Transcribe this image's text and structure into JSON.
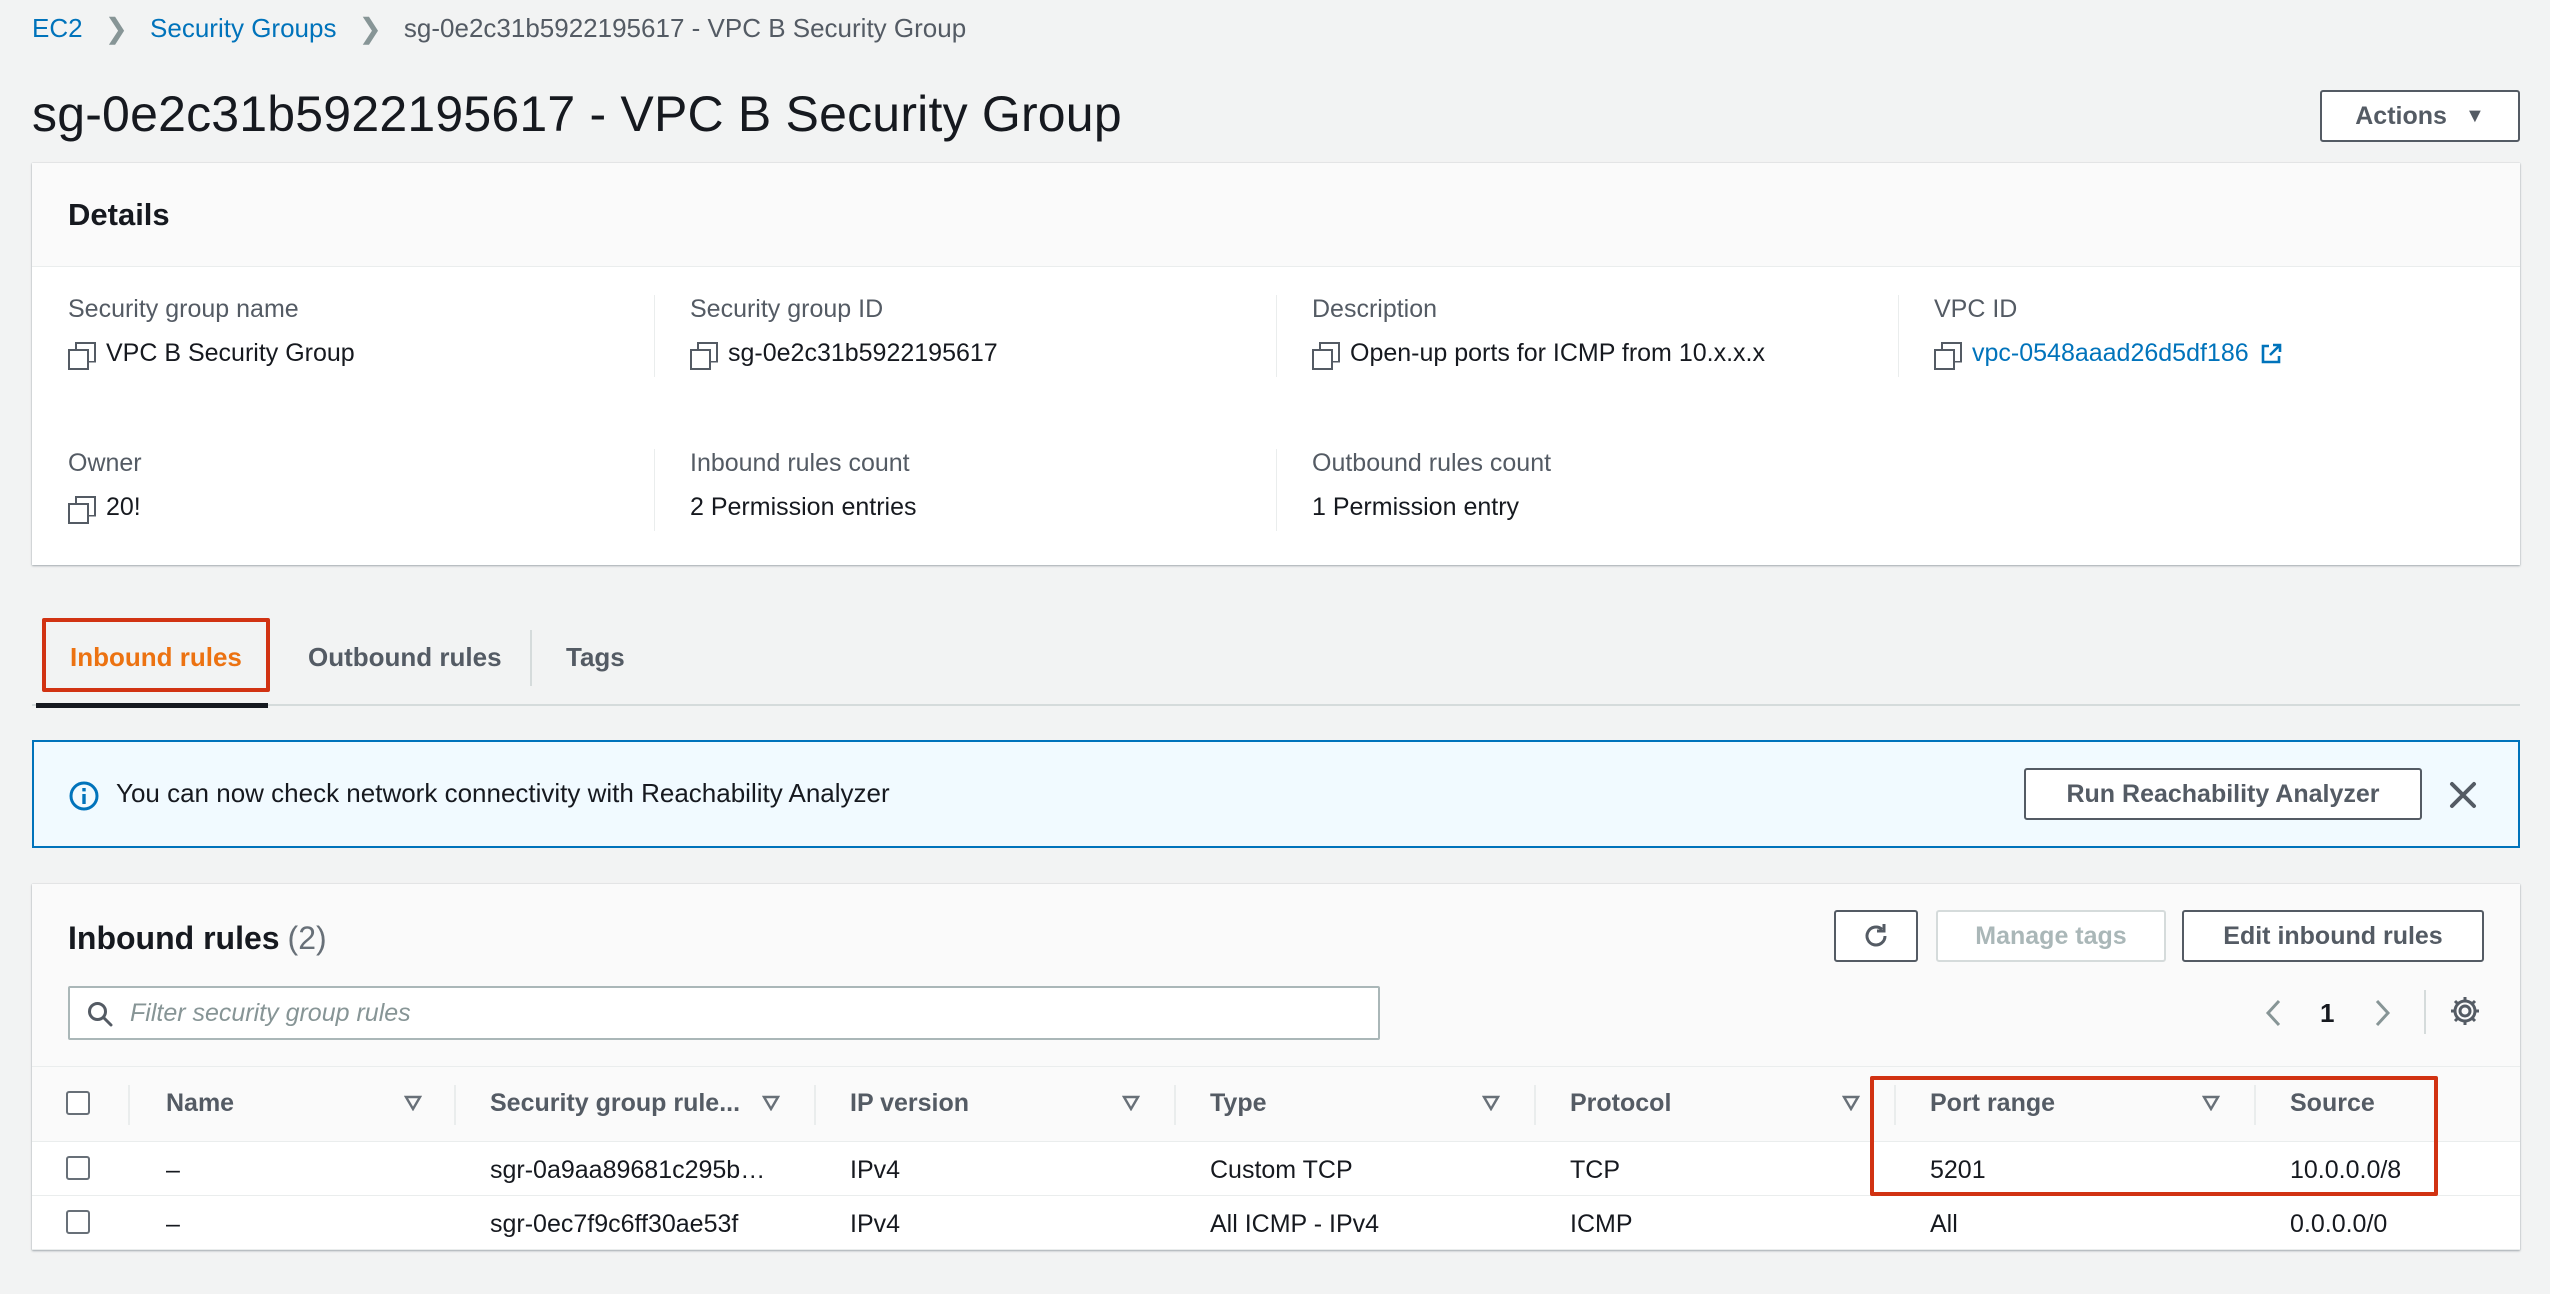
{
  "breadcrumb": {
    "items": [
      "EC2",
      "Security Groups"
    ],
    "current": "sg-0e2c31b5922195617 - VPC B Security Group"
  },
  "page": {
    "title": "sg-0e2c31b5922195617 - VPC B Security Group",
    "actions_label": "Actions"
  },
  "details": {
    "heading": "Details",
    "fields": [
      {
        "label": "Security group name",
        "value": "VPC B Security Group"
      },
      {
        "label": "Security group ID",
        "value": "sg-0e2c31b5922195617"
      },
      {
        "label": "Description",
        "value": "Open-up ports for ICMP from 10.x.x.x"
      },
      {
        "label": "VPC ID",
        "value": "vpc-0548aaad26d5df186"
      },
      {
        "label": "Owner",
        "value": "20!"
      },
      {
        "label": "Inbound rules count",
        "value": "2 Permission entries"
      },
      {
        "label": "Outbound rules count",
        "value": "1 Permission entry"
      }
    ]
  },
  "tabs": [
    {
      "label": "Inbound rules",
      "active": true
    },
    {
      "label": "Outbound rules",
      "active": false
    },
    {
      "label": "Tags",
      "active": false
    }
  ],
  "alert": {
    "message": "You can now check network connectivity with Reachability Analyzer",
    "button_label": "Run Reachability Analyzer"
  },
  "rules": {
    "title": "Inbound rules",
    "count": "(2)",
    "manage_tags_label": "Manage tags",
    "edit_label": "Edit inbound rules",
    "search_placeholder": "Filter security group rules",
    "page_number": "1",
    "columns": [
      "Name",
      "Security group rule...",
      "IP version",
      "Type",
      "Protocol",
      "Port range",
      "Source"
    ],
    "rows": [
      {
        "name": "–",
        "rule_id": "sgr-0a9aa89681c295b…",
        "ip_version": "IPv4",
        "type": "Custom TCP",
        "protocol": "TCP",
        "port_range": "5201",
        "source": "10.0.0.0/8"
      },
      {
        "name": "–",
        "rule_id": "sgr-0ec7f9c6ff30ae53f",
        "ip_version": "IPv4",
        "type": "All ICMP - IPv4",
        "protocol": "ICMP",
        "port_range": "All",
        "source": "0.0.0.0/0"
      }
    ]
  },
  "colors": {
    "link": "#0073bb",
    "active_tab": "#ec7211",
    "highlight": "#d13212",
    "alert_bg": "#f1faff"
  },
  "icons": [
    "chevron-right-icon",
    "caret-down-icon",
    "copy-icon",
    "external-link-icon",
    "info-icon",
    "close-icon",
    "refresh-icon",
    "search-icon",
    "chevron-left-icon",
    "gear-icon",
    "sort-icon"
  ]
}
